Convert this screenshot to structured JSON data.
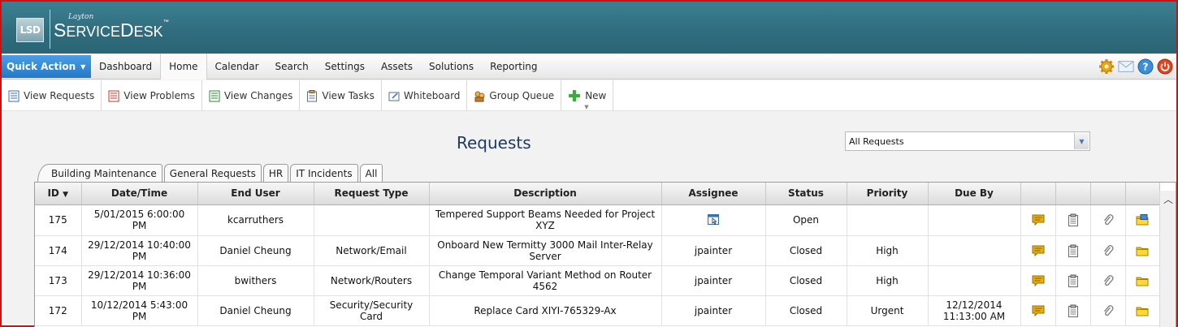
{
  "app": {
    "logo_abbr": "LSD",
    "logo_brand": "Layton",
    "logo_name_s": "S",
    "logo_name_ervice": "ERVICE",
    "logo_name_d": "D",
    "logo_name_esk": "ESK",
    "logo_tm": "™"
  },
  "nav": {
    "quick_action": "Quick Action",
    "items": [
      {
        "label": "Dashboard"
      },
      {
        "label": "Home"
      },
      {
        "label": "Calendar"
      },
      {
        "label": "Search"
      },
      {
        "label": "Settings"
      },
      {
        "label": "Assets"
      },
      {
        "label": "Solutions"
      },
      {
        "label": "Reporting"
      }
    ],
    "active": "Home",
    "icons": [
      "gear-icon",
      "mail-icon",
      "help-icon",
      "power-icon"
    ]
  },
  "toolbar": {
    "items": [
      {
        "label": "View Requests",
        "icon": "requests-icon"
      },
      {
        "label": "View Problems",
        "icon": "problems-icon"
      },
      {
        "label": "View Changes",
        "icon": "changes-icon"
      },
      {
        "label": "View Tasks",
        "icon": "tasks-icon"
      },
      {
        "label": "Whiteboard",
        "icon": "whiteboard-icon"
      },
      {
        "label": "Group Queue",
        "icon": "group-queue-icon"
      },
      {
        "label": "New",
        "icon": "plus-icon"
      }
    ]
  },
  "main": {
    "title": "Requests",
    "view_select": "All Requests",
    "tabs": [
      {
        "label": "Building Maintenance"
      },
      {
        "label": "General Requests"
      },
      {
        "label": "HR"
      },
      {
        "label": "IT Incidents"
      },
      {
        "label": "All"
      }
    ]
  },
  "grid": {
    "columns": [
      "ID",
      "Date/Time",
      "End User",
      "Request Type",
      "Description",
      "Assignee",
      "Status",
      "Priority",
      "Due By"
    ],
    "sort_indicator": "▼",
    "rows": [
      {
        "id": "175",
        "datetime": "5/01/2015 6:00:00 PM",
        "end_user": "kcarruthers",
        "request_type": "",
        "description": "Tempered Support Beams Needed for Project XYZ",
        "assignee": "",
        "status": "Open",
        "priority": "",
        "due_by": ""
      },
      {
        "id": "174",
        "datetime": "29/12/2014 10:40:00 PM",
        "end_user": "Daniel Cheung",
        "request_type": "Network/Email",
        "description": "Onboard New Termitty 3000 Mail Inter-Relay Server",
        "assignee": "jpainter",
        "status": "Closed",
        "priority": "High",
        "due_by": ""
      },
      {
        "id": "173",
        "datetime": "29/12/2014 10:36:00 PM",
        "end_user": "bwithers",
        "request_type": "Network/Routers",
        "description": "Change Temporal Variant Method on Router 4562",
        "assignee": "jpainter",
        "status": "Closed",
        "priority": "High",
        "due_by": ""
      },
      {
        "id": "172",
        "datetime": "10/12/2014 5:43:00 PM",
        "end_user": "Daniel Cheung",
        "request_type": "Security/Security Card",
        "description": "Replace Card XIYI-765329-Ax",
        "assignee": "jpainter",
        "status": "Closed",
        "priority": "Urgent",
        "due_by": "12/12/2014 11:13:00 AM"
      }
    ],
    "row_icons": [
      "note-icon",
      "clipboard-icon",
      "paperclip-icon",
      "folder-icon"
    ],
    "colors": {
      "note": "#e0a800",
      "folder": "#f2c200",
      "accent": "#2578c4"
    }
  }
}
